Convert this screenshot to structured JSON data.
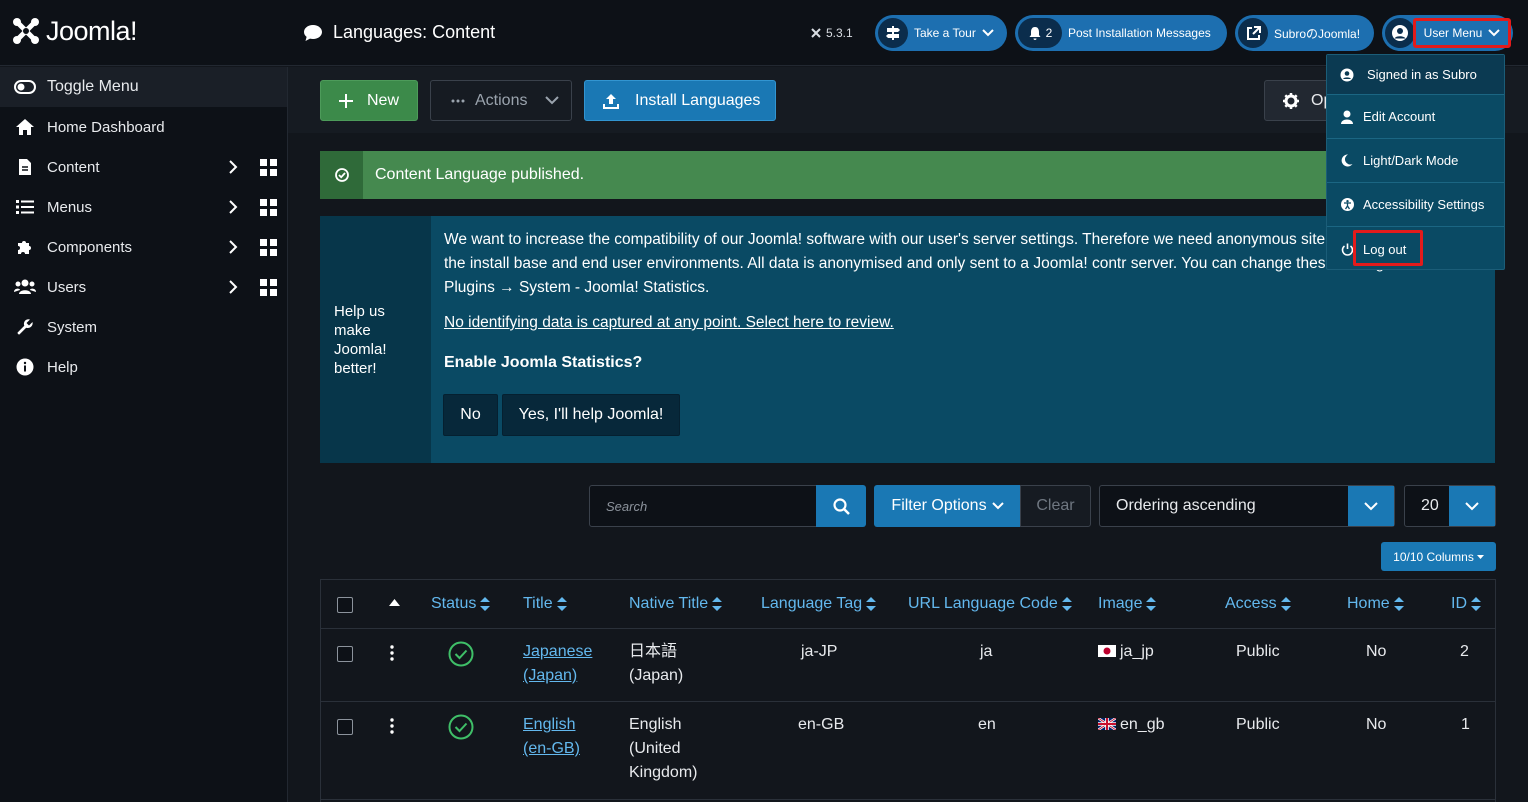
{
  "header": {
    "brand": "Joomla!",
    "page_title": "Languages: Content",
    "version": "5.3.1",
    "take_tour": "Take a Tour",
    "notifications_count": "2",
    "post_install": "Post Installation Messages",
    "site_link": "SubroのJoomla!",
    "user_menu": "User Menu"
  },
  "sidebar": {
    "toggle": "Toggle Menu",
    "items": [
      {
        "label": "Home Dashboard"
      },
      {
        "label": "Content"
      },
      {
        "label": "Menus"
      },
      {
        "label": "Components"
      },
      {
        "label": "Users"
      },
      {
        "label": "System"
      },
      {
        "label": "Help"
      }
    ]
  },
  "toolbar": {
    "new": "New",
    "actions": "Actions",
    "install": "Install Languages",
    "options": "Op"
  },
  "alert": {
    "message": "Content Language published."
  },
  "stats": {
    "side": "Help us make Joomla! better!",
    "body": "We want to increase the compatibility of our Joomla! software with our user's server settings. Therefore we need anonymous site to better understand the install base and end user environments. All data is anonymised and only sent to a Joomla! contr server. You can change these settings later from Plugins → System - Joomla! Statistics.",
    "link": "No identifying data is captured at any point. Select here to review.",
    "question": "Enable Joomla Statistics?",
    "no": "No",
    "yes": "Yes, I'll help Joomla!"
  },
  "filters": {
    "search_placeholder": "Search",
    "filter_options": "Filter Options",
    "clear": "Clear",
    "ordering": "Ordering ascending",
    "limit": "20",
    "columns": "10/10 Columns"
  },
  "table": {
    "headers": {
      "status": "Status",
      "title": "Title",
      "native_title": "Native Title",
      "language_tag": "Language Tag",
      "url_code": "URL Language Code",
      "image": "Image",
      "access": "Access",
      "home": "Home",
      "id": "ID"
    },
    "rows": [
      {
        "title_line1": "Japanese",
        "title_line2": "(Japan)",
        "native_line1": "日本語",
        "native_line2": "(Japan)",
        "native_line3": "",
        "tag": "ja-JP",
        "url_code": "ja",
        "image": "ja_jp",
        "access": "Public",
        "home": "No",
        "id": "2"
      },
      {
        "title_line1": "English",
        "title_line2": "(en-GB)",
        "native_line1": "English",
        "native_line2": "(United",
        "native_line3": "Kingdom)",
        "tag": "en-GB",
        "url_code": "en",
        "image": "en_gb",
        "access": "Public",
        "home": "No",
        "id": "1"
      }
    ]
  },
  "user_dropdown": {
    "signed_in": "Signed in as Subro",
    "edit_account": "Edit Account",
    "light_dark": "Light/Dark Mode",
    "accessibility": "Accessibility Settings",
    "logout": "Log out"
  },
  "colors": {
    "accent": "#1a78b4",
    "success": "#45894f",
    "highlight": "#e31b1b",
    "stats_bg": "#0a4a64"
  }
}
